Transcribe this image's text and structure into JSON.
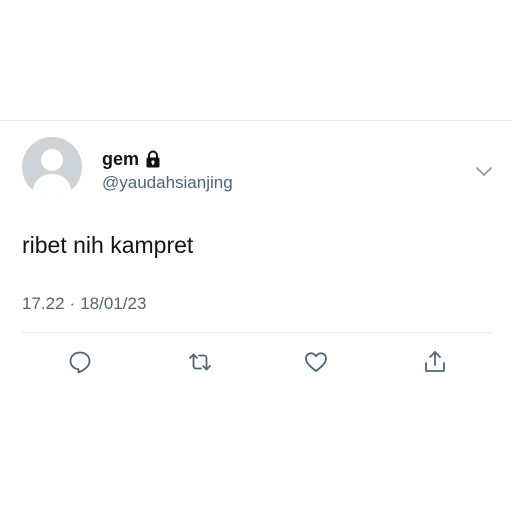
{
  "tweet": {
    "display_name": "gem",
    "handle": "@yaudahsianjing",
    "protected_icon": "lock-icon",
    "text": "ribet nih kampret",
    "time": "17.22",
    "separator": "·",
    "date": "18/01/23"
  },
  "actions": [
    {
      "name": "reply",
      "icon": "speech-bubble-icon"
    },
    {
      "name": "retweet",
      "icon": "retweet-arrows-icon"
    },
    {
      "name": "like",
      "icon": "heart-outline-icon"
    },
    {
      "name": "share",
      "icon": "share-upload-icon"
    }
  ],
  "menu_icon": "chevron-down-icon",
  "colors": {
    "text_primary": "#0f1419",
    "text_secondary": "#536471",
    "divider": "#e1e6ea",
    "avatar_bg": "#ccd3d9"
  }
}
